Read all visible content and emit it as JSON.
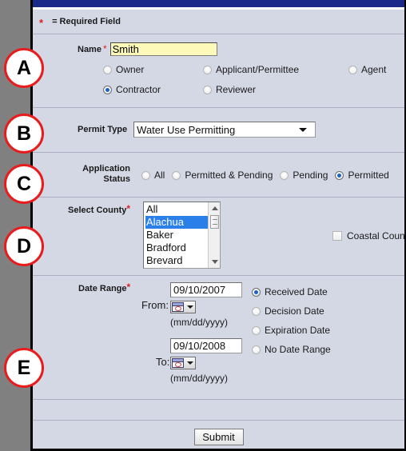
{
  "window": {
    "title_bar_color": "#1b2a8a",
    "panel_background": "#d4d8e4",
    "required_note": "= Required Field"
  },
  "name_section": {
    "label": "Name",
    "required_marker": "*",
    "value": "Smith",
    "placeholder": "",
    "field_background": "#fdf9b8",
    "role_options": [
      {
        "label": "Owner",
        "selected": false
      },
      {
        "label": "Applicant/Permittee",
        "selected": false
      },
      {
        "label": "Agent",
        "selected": false
      },
      {
        "label": "Contractor",
        "selected": true
      },
      {
        "label": "Reviewer",
        "selected": false
      }
    ]
  },
  "permit_type": {
    "label": "Permit Type",
    "selected": "Water Use Permitting",
    "caret_icon": "chevron-down-icon"
  },
  "application_status": {
    "label_line1": "Application",
    "label_line2": "Status",
    "options": [
      {
        "label": "All",
        "selected": false
      },
      {
        "label": "Permitted & Pending",
        "selected": false
      },
      {
        "label": "Pending",
        "selected": false
      },
      {
        "label": "Permitted",
        "selected": true
      }
    ]
  },
  "county": {
    "label": "Select County",
    "required_marker": "*",
    "items": [
      {
        "label": "All",
        "selected": false
      },
      {
        "label": "Alachua",
        "selected": true
      },
      {
        "label": "Baker",
        "selected": false
      },
      {
        "label": "Bradford",
        "selected": false
      },
      {
        "label": "Brevard",
        "selected": false
      }
    ],
    "selection_color": "#2a7fe8",
    "scrollbar": {
      "up_icon": "triangle-up-icon",
      "down_icon": "triangle-down-icon",
      "thumb_icon": "scroll-thumb"
    },
    "coastal": {
      "label": "Coastal Counties",
      "checked": false
    }
  },
  "date_range": {
    "label": "Date Range",
    "required_marker": "*",
    "from": {
      "label": "From:",
      "value": "09/10/2007",
      "hint": "(mm/dd/yyyy)",
      "calendar_icon": "calendar-icon"
    },
    "to": {
      "label": "To:",
      "value": "09/10/2008",
      "hint": "(mm/dd/yyyy)",
      "calendar_icon": "calendar-icon"
    },
    "date_type_options": [
      {
        "label": "Received Date",
        "selected": true
      },
      {
        "label": "Decision Date",
        "selected": false
      },
      {
        "label": "Expiration Date",
        "selected": false
      },
      {
        "label": "No Date Range",
        "selected": false
      }
    ]
  },
  "submit": {
    "label": "Submit"
  },
  "annotations": {
    "color": "#e81c1c",
    "markers": [
      {
        "label": "A"
      },
      {
        "label": "B"
      },
      {
        "label": "C"
      },
      {
        "label": "D"
      },
      {
        "label": "E"
      }
    ]
  }
}
